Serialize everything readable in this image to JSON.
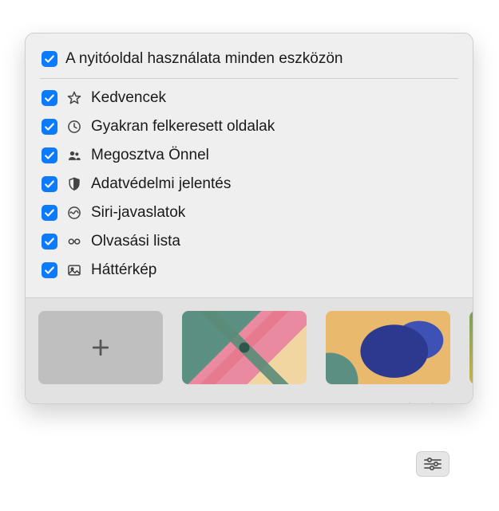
{
  "popover": {
    "header": {
      "checked": true,
      "label": "A nyitóoldal használata minden eszközön"
    },
    "items": [
      {
        "checked": true,
        "icon": "star-icon",
        "label": "Kedvencek"
      },
      {
        "checked": true,
        "icon": "clock-icon",
        "label": "Gyakran felkeresett oldalak"
      },
      {
        "checked": true,
        "icon": "people-icon",
        "label": "Megosztva Önnel"
      },
      {
        "checked": true,
        "icon": "shield-icon",
        "label": "Adatvédelmi jelentés"
      },
      {
        "checked": true,
        "icon": "siri-icon",
        "label": "Siri-javaslatok"
      },
      {
        "checked": true,
        "icon": "glasses-icon",
        "label": "Olvasási lista"
      },
      {
        "checked": true,
        "icon": "image-icon",
        "label": "Háttérkép"
      }
    ]
  },
  "thumbnails": {
    "add_label": "+"
  }
}
